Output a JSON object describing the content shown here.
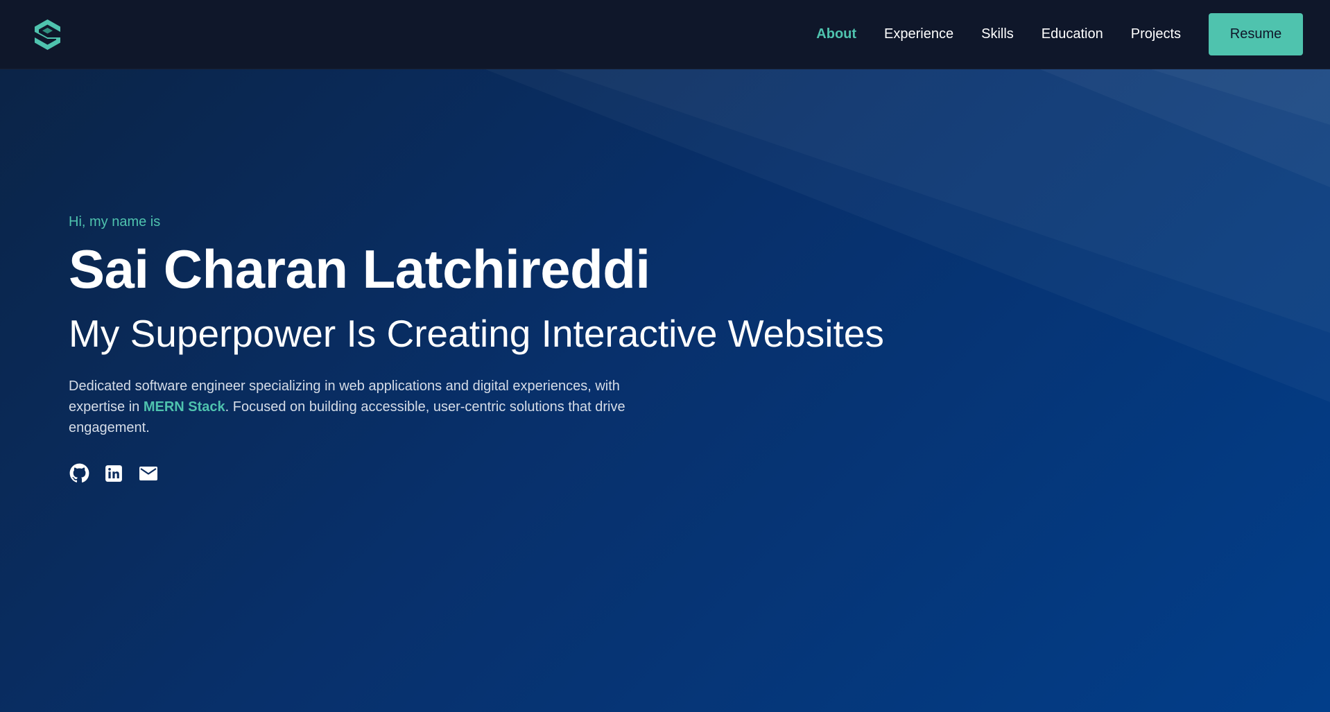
{
  "navbar": {
    "logo_icon": "hexagon-s-logo-icon",
    "items": [
      {
        "label": "About",
        "active": true
      },
      {
        "label": "Experience",
        "active": false
      },
      {
        "label": "Skills",
        "active": false
      },
      {
        "label": "Education",
        "active": false
      },
      {
        "label": "Projects",
        "active": false
      }
    ],
    "resume_label": "Resume"
  },
  "hero": {
    "greeting": "Hi, my name is",
    "name": "Sai Charan Latchireddi",
    "tagline": "My Superpower Is Creating Interactive Websites",
    "bio_part1": "Dedicated software engineer specializing in web applications and digital experiences, with expertise in ",
    "bio_highlight": "MERN Stack",
    "bio_part2": ". Focused on building accessible, user-centric solutions that drive engagement.",
    "socials": [
      {
        "icon": "github-icon"
      },
      {
        "icon": "linkedin-icon"
      },
      {
        "icon": "mail-icon"
      }
    ]
  },
  "colors": {
    "accent": "#4fc3ae",
    "navbar_bg": "#0f172a",
    "hero_gradient_start": "#0b2447",
    "hero_gradient_end": "#023e8a",
    "text_primary": "#ffffff",
    "text_secondary": "#d6dde8"
  }
}
